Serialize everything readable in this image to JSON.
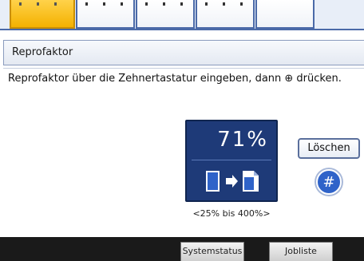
{
  "tabs": [
    {
      "active": true
    },
    {
      "active": false
    },
    {
      "active": false
    },
    {
      "active": false
    },
    {
      "active": false
    }
  ],
  "header": {
    "title": "Reprofaktor"
  },
  "instruction": "Reprofaktor über die Zehnertastatur eingeben, dann ⊕ drücken.",
  "panel": {
    "value": "71%",
    "icon": "original-to-copy-icon",
    "range": "<25% bis 400%>"
  },
  "buttons": {
    "clear_label": "Löschen",
    "hash_label": "#"
  },
  "bottom": {
    "system_status": "Systemstatus",
    "job_list": "Jobliste"
  },
  "colors": {
    "active_tab": "#f4b100",
    "panel_bg": "#1e3a78",
    "accent_blue": "#2f63c9"
  }
}
